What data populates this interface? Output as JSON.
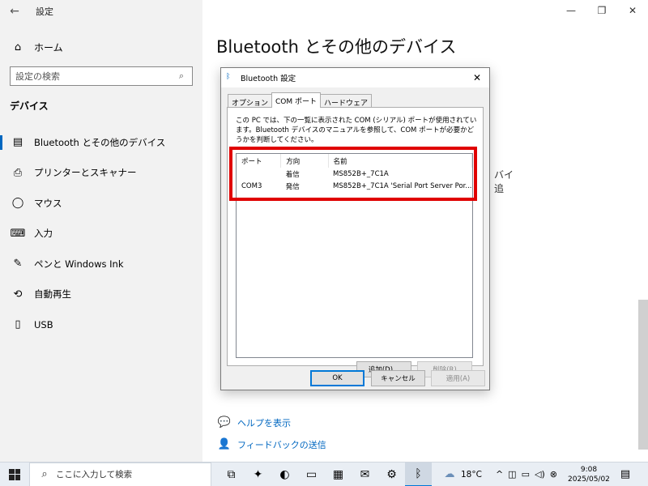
{
  "settings": {
    "app_title": "設定",
    "back_icon": "arrow-left-icon",
    "home_label": "ホーム",
    "search_placeholder": "設定の検索",
    "section_title": "デバイス",
    "nav_items": [
      {
        "label": "Bluetooth とその他のデバイス",
        "icon": "bluetooth-devices-icon",
        "glyph": "▤"
      },
      {
        "label": "プリンターとスキャナー",
        "icon": "printer-icon",
        "glyph": "⎙"
      },
      {
        "label": "マウス",
        "icon": "mouse-icon",
        "glyph": "◯"
      },
      {
        "label": "入力",
        "icon": "keyboard-icon",
        "glyph": "⌨"
      },
      {
        "label": "ペンと Windows Ink",
        "icon": "pen-icon",
        "glyph": "✎"
      },
      {
        "label": "自動再生",
        "icon": "autoplay-icon",
        "glyph": "⟲"
      },
      {
        "label": "USB",
        "icon": "usb-icon",
        "glyph": "▯"
      }
    ],
    "page_title": "Bluetooth とその他のデバイス",
    "help_links": [
      {
        "label": "ヘルプを表示",
        "icon": "help-chat-icon",
        "glyph": "💬"
      },
      {
        "label": "フィードバックの送信",
        "icon": "feedback-icon",
        "glyph": "👤"
      }
    ],
    "bg_fragments": [
      "バイ",
      "追"
    ]
  },
  "dialog": {
    "title": "Bluetooth 設定",
    "tabs": [
      "オプション",
      "COM ポート",
      "ハードウェア"
    ],
    "active_tab": 1,
    "description": "この PC では、下の一覧に表示された COM (シリアル) ポートが使用されています。Bluetooth デバイスのマニュアルを参照して、COM ポートが必要かどうかを判断してください。",
    "columns": [
      "ポート",
      "方向",
      "名前"
    ],
    "rows": [
      {
        "port": "",
        "direction": "着信",
        "name": "MS852B+_7C1A"
      },
      {
        "port": "COM3",
        "direction": "発信",
        "name": "MS852B+_7C1A 'Serial Port Server Por..."
      }
    ],
    "add_label": "追加(D)...",
    "remove_label": "削除(R)",
    "ok_label": "OK",
    "cancel_label": "キャンセル",
    "apply_label": "適用(A)",
    "highlight_color": "#e00000"
  },
  "taskbar": {
    "search_placeholder": "ここに入力して検索",
    "apps": [
      {
        "name": "task-view-icon",
        "glyph": "⧉"
      },
      {
        "name": "copilot-icon",
        "glyph": "✦"
      },
      {
        "name": "edge-icon",
        "glyph": "◐"
      },
      {
        "name": "file-explorer-icon",
        "glyph": "▭"
      },
      {
        "name": "store-icon",
        "glyph": "▦"
      },
      {
        "name": "mail-icon",
        "glyph": "✉"
      },
      {
        "name": "settings-gear-icon",
        "glyph": "⚙"
      },
      {
        "name": "bluetooth-icon",
        "glyph": "ᛒ"
      }
    ],
    "active_app": 7,
    "weather_temp": "18°C",
    "time": "9:08",
    "date": "2025/05/02"
  }
}
